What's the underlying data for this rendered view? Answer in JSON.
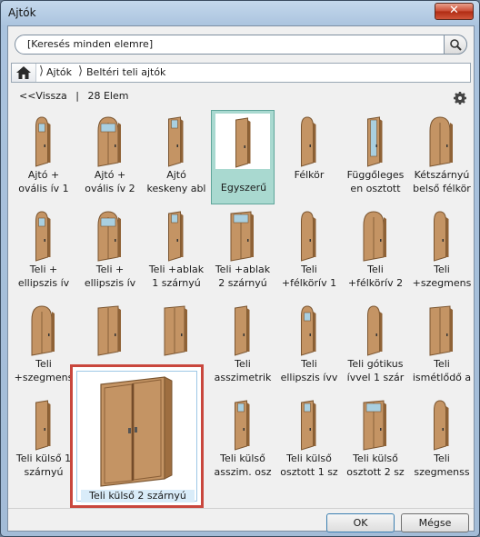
{
  "window": {
    "title": "Ajtók",
    "close_label": "✕"
  },
  "search": {
    "placeholder": "[Keresés minden elemre]",
    "icon": "search-icon"
  },
  "breadcrumb": {
    "items": [
      "Ajtók",
      "Beltéri teli ajtók"
    ]
  },
  "toolbar": {
    "back_label": "<<Vissza",
    "separator": "|",
    "count_label": "28 Elem"
  },
  "grid": {
    "items": [
      {
        "l1": "Ajtó +",
        "l2": "ovális ív 1"
      },
      {
        "l1": "Ajtó +",
        "l2": "ovális ív 2"
      },
      {
        "l1": "Ajtó",
        "l2": "keskeny abl"
      },
      {
        "l1": "Egyszerű",
        "l2": ""
      },
      {
        "l1": "Félkör",
        "l2": ""
      },
      {
        "l1": "Függőleges",
        "l2": "en osztott"
      },
      {
        "l1": "Kétszárnyú",
        "l2": "belső félkör"
      },
      {
        "l1": "Teli +",
        "l2": "ellipszis ív"
      },
      {
        "l1": "Teli +",
        "l2": "ellipszis ív"
      },
      {
        "l1": "Teli +ablak",
        "l2": "1 szárnyú"
      },
      {
        "l1": "Teli +ablak",
        "l2": "2 szárnyú"
      },
      {
        "l1": "Teli",
        "l2": "+félkörív 1"
      },
      {
        "l1": "Teli",
        "l2": "+félkörív 2"
      },
      {
        "l1": "Teli",
        "l2": "+szegmens"
      },
      {
        "l1": "Teli",
        "l2": "+szegmens"
      },
      {
        "l1": "",
        "l2": ""
      },
      {
        "l1": "",
        "l2": ""
      },
      {
        "l1": "Teli",
        "l2": "asszimetrik"
      },
      {
        "l1": "Teli",
        "l2": "ellipszis ívv"
      },
      {
        "l1": "Teli gótikus",
        "l2": "ívvel 1 szár"
      },
      {
        "l1": "Teli",
        "l2": "ismétlődő a"
      },
      {
        "l1": "Teli külső 1",
        "l2": "szárnyú"
      },
      {
        "l1": "",
        "l2": ""
      },
      {
        "l1": "",
        "l2": "sz"
      },
      {
        "l1": "Teli külső",
        "l2": "asszim. osz"
      },
      {
        "l1": "Teli külső",
        "l2": "osztott 1 sz"
      },
      {
        "l1": "Teli külső",
        "l2": "osztott 2 sz"
      },
      {
        "l1": "Teli",
        "l2": "szegmenss"
      }
    ],
    "selected_label": "Egyszerű",
    "hover_popup_label": "Teli külső 2 szárnyú"
  },
  "buttons": {
    "ok": "OK",
    "cancel": "Mégse"
  },
  "colors": {
    "door_wood": "#c49464",
    "door_frame": "#7a5530",
    "selection": "#a9d9d0",
    "popup_border": "#c9473d"
  }
}
